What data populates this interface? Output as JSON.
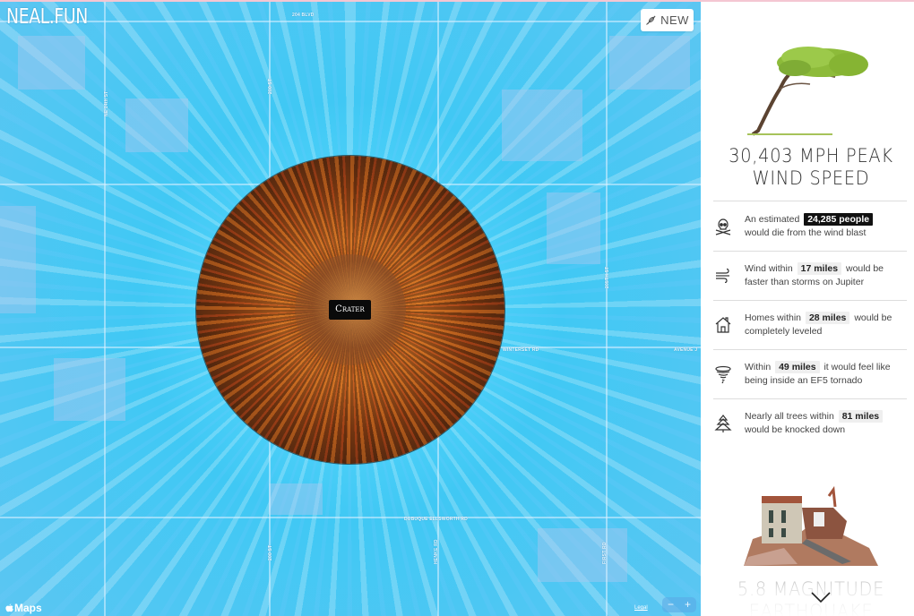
{
  "app": {
    "logo": "NEAL.FUN",
    "new_button_label": "NEW",
    "new_button_icon": "rocket-icon"
  },
  "map": {
    "crater_label": "Crater",
    "attribution": "Maps",
    "legal_link": "Legal",
    "zoom_out_label": "−",
    "zoom_in_label": "+",
    "road_labels": {
      "top": "204 BLVD",
      "left_vertical": "NE 14th ST",
      "upper_vertical": "200 ST",
      "right_vertical": "205TH ST",
      "middle_right": "WINTERSET RD",
      "far_right": "AVENUE J",
      "bottom": "DUBUQUE ELLSWORTH RD",
      "bottom_vertical_1": "200 ST",
      "bottom_vertical_2": "HENKE RD",
      "bottom_vertical_3": "FIRST RD"
    },
    "colors": {
      "blast_zone": "#40c8f4",
      "crater": "#a3541c"
    }
  },
  "sidebar": {
    "wind_section": {
      "image": "bent-tree",
      "title_line1": "30,403 MPH PEAK",
      "title_line2": "WIND SPEED",
      "facts": [
        {
          "icon": "skull-crossbones-icon",
          "before": "An estimated",
          "highlight": "24,285 people",
          "highlight_style": "dark",
          "after": "would die from the wind blast"
        },
        {
          "icon": "wind-icon",
          "before": "Wind within",
          "highlight": "17 miles",
          "highlight_style": "light",
          "after": "would be faster than storms on Jupiter"
        },
        {
          "icon": "house-icon",
          "before": "Homes within",
          "highlight": "28 miles",
          "highlight_style": "light",
          "after": "would be completely leveled"
        },
        {
          "icon": "tornado-icon",
          "before": "Within",
          "highlight": "49 miles",
          "highlight_style": "light",
          "after": "it would feel like being inside an EF5 tornado"
        },
        {
          "icon": "pine-tree-icon",
          "before": "Nearly all trees within",
          "highlight": "81 miles",
          "highlight_style": "light",
          "after": "would be knocked down"
        }
      ]
    },
    "earthquake_section": {
      "image": "collapsed-building",
      "title_line1": "5.8 MAGNITUDE",
      "title_line2": "EARTHQUAKE"
    },
    "scroll_icon": "chevron-down-icon"
  }
}
